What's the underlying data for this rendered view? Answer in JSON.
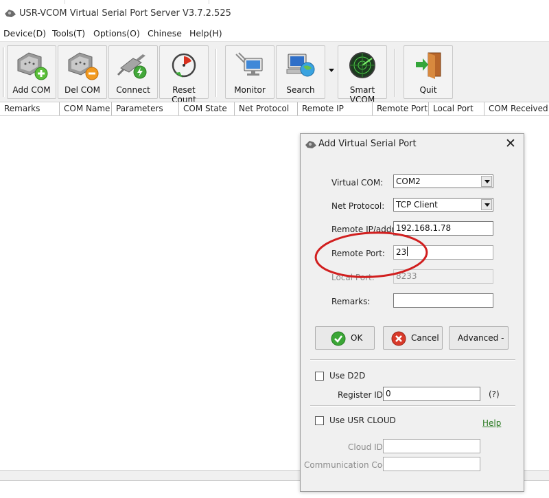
{
  "app": {
    "title": "USR-VCOM Virtual Serial Port Server V3.7.2.525",
    "icon": "usr-vcom-app-icon"
  },
  "menu": [
    "Device(D)",
    "Tools(T)",
    "Options(O)",
    "Chinese",
    "Help(H)"
  ],
  "toolbar": {
    "add_com": "Add COM",
    "del_com": "Del COM",
    "connect": "Connect",
    "reset_count": "Reset Count",
    "monitor": "Monitor",
    "search": "Search",
    "smart_vcom": "Smart VCOM",
    "quit": "Quit"
  },
  "table": {
    "columns": [
      "Remarks",
      "COM Name",
      "Parameters",
      "COM State",
      "Net Protocol",
      "Remote IP",
      "Remote Port",
      "Local Port",
      "COM Received"
    ]
  },
  "dialog": {
    "title": "Add Virtual Serial Port",
    "close_glyph": "✕",
    "virtual_com_label": "Virtual COM:",
    "virtual_com_value": "COM2",
    "net_protocol_label": "Net Protocol:",
    "net_protocol_value": "TCP Client",
    "remote_ip_label": "Remote IP/addr:",
    "remote_ip_value": "192.168.1.78",
    "remote_port_label": "Remote Port:",
    "remote_port_value": "23",
    "local_port_label": "Local Port:",
    "local_port_value": "8233",
    "remarks_label": "Remarks:",
    "remarks_value": "",
    "ok_label": "OK",
    "cancel_label": "Cancel",
    "advanced_label": "Advanced -",
    "use_d2d_label": "Use D2D",
    "register_id_label": "Register ID",
    "register_id_value": "0",
    "register_id_hint": "(?)",
    "use_usr_cloud_label": "Use USR CLOUD",
    "help_label": "Help",
    "cloud_id_label": "Cloud ID",
    "cloud_id_value": "",
    "comm_code_label": "Communication Code",
    "comm_code_value": ""
  },
  "colors": {
    "toolbar_bg": "#f0f0f0",
    "dialog_bg": "#f0f0f0",
    "annotation_red": "#d11f1f",
    "help_link": "#2a7a22",
    "ok_green": "#3aa635",
    "cancel_red": "#d83a2a"
  }
}
